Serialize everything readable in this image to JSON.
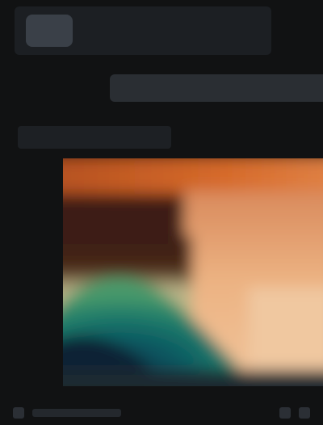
{
  "header": {
    "icon": "app-logo-icon",
    "title": ""
  },
  "url_bar": {
    "value": ""
  },
  "section": {
    "label": ""
  },
  "image_tile": {
    "description_icon": "image-thumbnail"
  },
  "colors": {
    "background": "#111213",
    "accent_orange": "#d0692c",
    "peach": "#e9a978",
    "teal_dark": "#0b5c63",
    "navy": "#0c1e33"
  }
}
